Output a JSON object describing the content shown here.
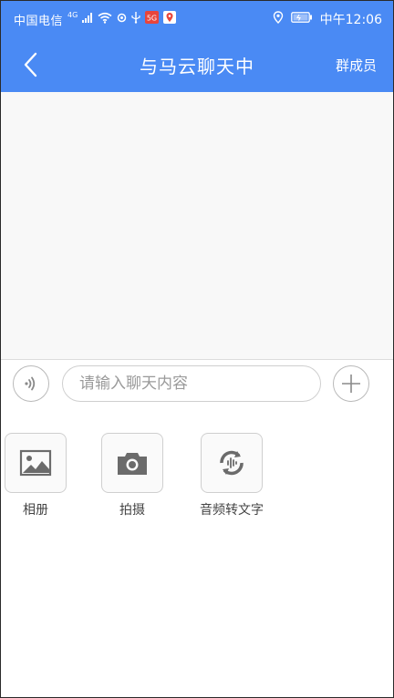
{
  "status_bar": {
    "carrier": "中国电信",
    "network": "4G",
    "time": "中午12:06",
    "icons": [
      "signal-icon",
      "wifi-icon",
      "sync-icon",
      "usb-icon",
      "app-5g-icon",
      "app-map-icon",
      "location-icon",
      "battery-icon"
    ]
  },
  "nav": {
    "back_icon": "back-chevron-icon",
    "title": "与马云聊天中",
    "action": "群成员"
  },
  "input_bar": {
    "voice_icon": "voice-icon",
    "placeholder": "请输入聊天内容",
    "value": "",
    "plus_icon": "plus-icon"
  },
  "tools": [
    {
      "label": "相册",
      "icon": "photo-album-icon"
    },
    {
      "label": "拍摄",
      "icon": "camera-icon"
    },
    {
      "label": "音频转文字",
      "icon": "audio-to-text-icon"
    }
  ],
  "colors": {
    "primary": "#4a8af4",
    "chat_bg": "#f8f8f8",
    "icon_gray": "#6b6b6b",
    "border": "#cfcfcf"
  }
}
